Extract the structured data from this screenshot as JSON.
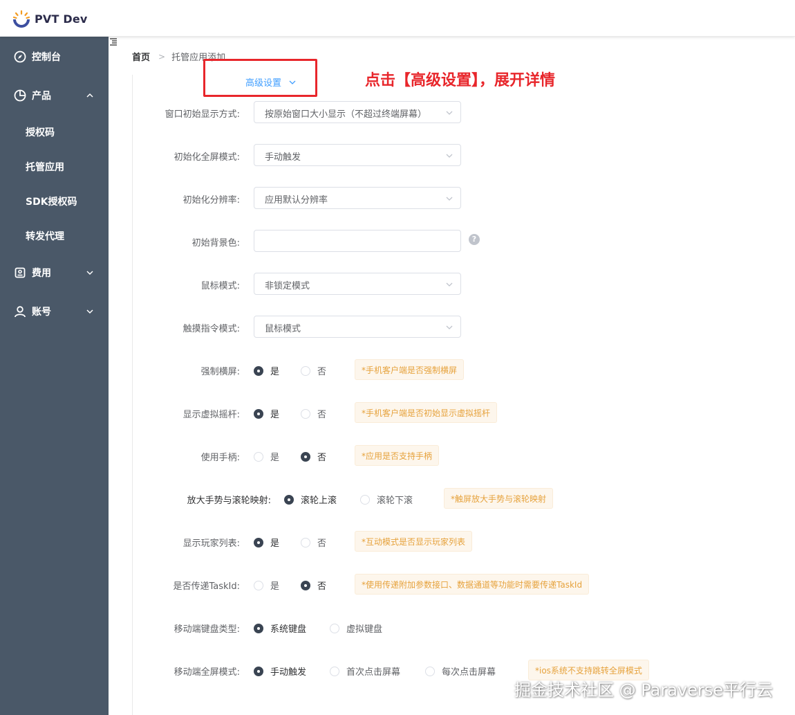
{
  "app": {
    "title": "PVT Dev"
  },
  "sidebar": {
    "items": [
      {
        "label": "控制台",
        "icon": "dashboard-icon"
      },
      {
        "label": "产品",
        "icon": "pie-chart-icon",
        "expanded": true
      },
      {
        "label": "授权码"
      },
      {
        "label": "托管应用"
      },
      {
        "label": "SDK授权码"
      },
      {
        "label": "转发代理"
      },
      {
        "label": "费用",
        "icon": "wallet-icon",
        "expanded": false
      },
      {
        "label": "账号",
        "icon": "user-icon",
        "expanded": false
      }
    ]
  },
  "breadcrumb": {
    "home": "首页",
    "current": "托管应用添加"
  },
  "advanced": {
    "label": "高级设置"
  },
  "annotation": "点击【高级设置】，展开详情",
  "form": {
    "window_mode": {
      "label": "窗口初始显示方式:",
      "value": "按原始窗口大小显示（不超过终端屏幕）"
    },
    "fullscreen": {
      "label": "初始化全屏模式:",
      "value": "手动触发"
    },
    "resolution": {
      "label": "初始化分辨率:",
      "value": "应用默认分辨率"
    },
    "bgcolor": {
      "label": "初始背景色:",
      "value": "",
      "help": "?"
    },
    "mouse": {
      "label": "鼠标模式:",
      "value": "非锁定模式"
    },
    "touch": {
      "label": "触摸指令模式:",
      "value": "鼠标模式"
    },
    "force_landscape": {
      "label": "强制横屏:",
      "options": [
        "是",
        "否"
      ],
      "selected": "是",
      "tip": "*手机客户端是否强制横屏"
    },
    "joystick": {
      "label": "显示虚拟摇杆:",
      "options": [
        "是",
        "否"
      ],
      "selected": "是",
      "tip": "*手机客户端是否初始显示虚拟摇杆"
    },
    "gamepad": {
      "label": "使用手柄:",
      "options": [
        "是",
        "否"
      ],
      "selected": "否",
      "tip": "*应用是否支持手柄"
    },
    "zoom_wheel": {
      "label": "放大手势与滚轮映射:",
      "options": [
        "滚轮上滚",
        "滚轮下滚"
      ],
      "selected": "滚轮上滚",
      "tip": "*触屏放大手势与滚轮映射"
    },
    "player_list": {
      "label": "显示玩家列表:",
      "options": [
        "是",
        "否"
      ],
      "selected": "是",
      "tip": "*互动模式是否显示玩家列表"
    },
    "task_id": {
      "label": "是否传递TaskId:",
      "options": [
        "是",
        "否"
      ],
      "selected": "否",
      "tip": "*使用传递附加参数接口、数据通道等功能时需要传递TaskId"
    },
    "keyboard": {
      "label": "移动端键盘类型:",
      "options": [
        "系统键盘",
        "虚拟键盘"
      ],
      "selected": "系统键盘"
    },
    "mobile_fullscreen": {
      "label": "移动端全屏模式:",
      "options": [
        "手动触发",
        "首次点击屏幕",
        "每次点击屏幕"
      ],
      "selected": "手动触发",
      "tip": "*ios系统不支持跳转全屏模式"
    }
  },
  "watermark": "掘金技术社区 @ Paraverse平行云",
  "colors": {
    "sidebar": "#4a5868",
    "accent": "#409eff",
    "annotation": "#e8262b",
    "radio_checked": "#3a4452",
    "tip_text": "#e6a23c"
  }
}
